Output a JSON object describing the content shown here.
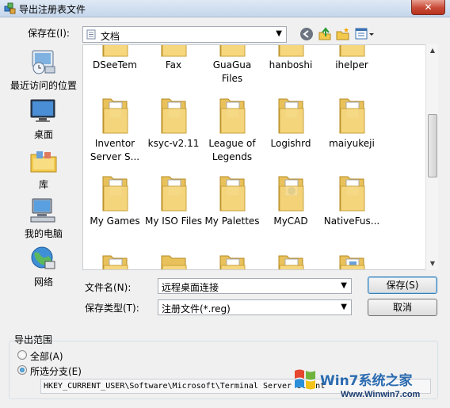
{
  "window": {
    "title": "导出注册表文件",
    "close": "✕"
  },
  "save_in": {
    "label": "保存在(I):",
    "value": "文档"
  },
  "places": [
    {
      "label": "最近访问的位置",
      "icon": "recent-places-icon"
    },
    {
      "label": "桌面",
      "icon": "desktop-icon"
    },
    {
      "label": "库",
      "icon": "libraries-icon"
    },
    {
      "label": "我的电脑",
      "icon": "computer-icon"
    },
    {
      "label": "网络",
      "icon": "network-icon"
    }
  ],
  "files": {
    "row0": [
      "DSeeTem",
      "Fax",
      "GuaGua Files",
      "hanboshi",
      "ihelper"
    ],
    "row1": [
      "Inventor Server S...",
      "ksyc-v2.11",
      "League of Legends",
      "Logishrd",
      "maiyukeji"
    ],
    "row2": [
      "My Games",
      "My ISO Files",
      "My Palettes",
      "MyCAD",
      "NativeFus..."
    ]
  },
  "filename": {
    "label": "文件名(N):",
    "value": "远程桌面连接"
  },
  "filetype": {
    "label": "保存类型(T):",
    "value": "注册文件(*.reg)"
  },
  "buttons": {
    "save": "保存(S)",
    "cancel": "取消"
  },
  "export_range": {
    "title": "导出范围",
    "options": [
      {
        "label": "全部(A)",
        "selected": false
      },
      {
        "label": "所选分支(E)",
        "selected": true
      }
    ],
    "key_path": "HKEY_CURRENT_USER\\Software\\Microsoft\\Terminal Server Client"
  },
  "watermark": {
    "title": "Win7系统之家",
    "url": "Www.Winwin7.com"
  },
  "colors": {
    "folder": "#f2d27a",
    "accent": "#2a6bb0",
    "close": "#c74a36"
  }
}
